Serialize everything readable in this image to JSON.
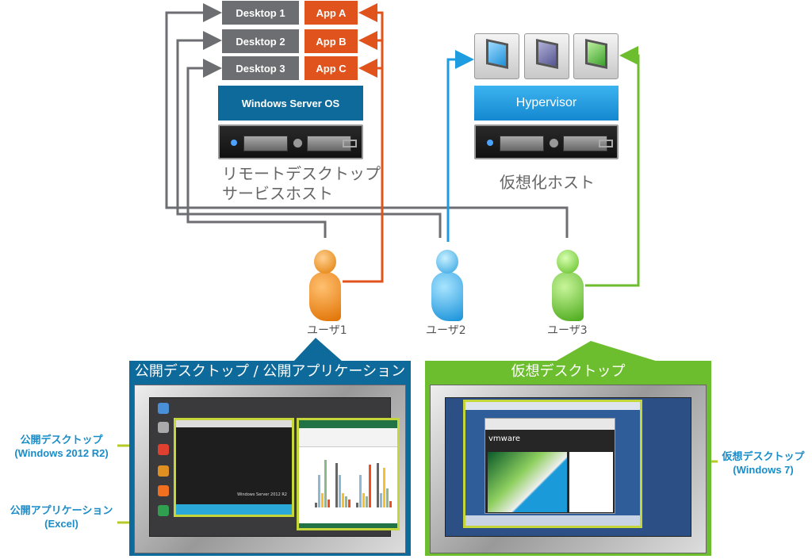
{
  "rds": {
    "desktops": [
      "Desktop 1",
      "Desktop 2",
      "Desktop 3"
    ],
    "apps": [
      "App A",
      "App B",
      "App C"
    ],
    "os_label": "Windows Server OS",
    "host_label_line1": "リモートデスクトップ",
    "host_label_line2": "サービスホスト"
  },
  "vdi": {
    "hypervisor_label": "Hypervisor",
    "host_label": "仮想化ホスト"
  },
  "users": [
    "ユーザ1",
    "ユーザ2",
    "ユーザ3"
  ],
  "panels": {
    "left_title": "公開デスクトップ / 公開アプリケーション",
    "right_title": "仮想デスクトップ"
  },
  "callouts": {
    "published_desktop": "公開デスクトップ",
    "published_desktop_os": "(Windows 2012 R2)",
    "published_app": "公開アプリケーション",
    "published_app_name": "(Excel)",
    "virtual_desktop": "仮想デスクトップ",
    "virtual_desktop_os": "(Windows 7)"
  },
  "screens": {
    "vmware_logo": "vmware",
    "server_brand": "Windows Server 2012 R2"
  },
  "colors": {
    "gray": "#6d6e71",
    "orange": "#e0531c",
    "blue": "#1d9ce0",
    "green": "#6cbe2e",
    "teal": "#0e6a9a",
    "callout": "#1a8cc8"
  }
}
